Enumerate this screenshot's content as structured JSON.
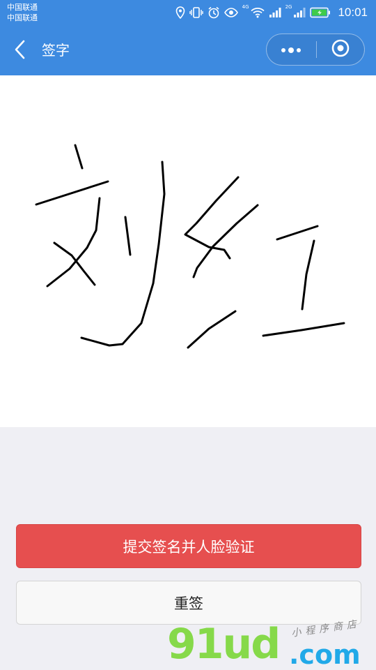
{
  "status_bar": {
    "carrier_1": "中国联通",
    "carrier_2": "中国联通",
    "network_1": "4G",
    "network_2": "2G",
    "time": "10:01",
    "icons": [
      "location-icon",
      "vibrate-icon",
      "alarm-icon",
      "eye-icon",
      "wifi-icon",
      "signal-icon",
      "battery-icon"
    ]
  },
  "navbar": {
    "title": "签字",
    "back_icon": "chevron-left-icon",
    "more_icon": "more-dots-icon",
    "close_icon": "target-circle-icon"
  },
  "signature": {
    "handwritten_text": "刘红",
    "background": "#ffffff",
    "stroke_color": "#000000"
  },
  "actions": {
    "submit_label": "提交签名并人脸验证",
    "reset_label": "重签"
  },
  "watermark": {
    "main": "91ud",
    "suffix": ".com",
    "tagline": "小程序商店"
  },
  "colors": {
    "header": "#3d8ae0",
    "primary_button": "#e64f4f",
    "page_background": "#efeff4"
  }
}
